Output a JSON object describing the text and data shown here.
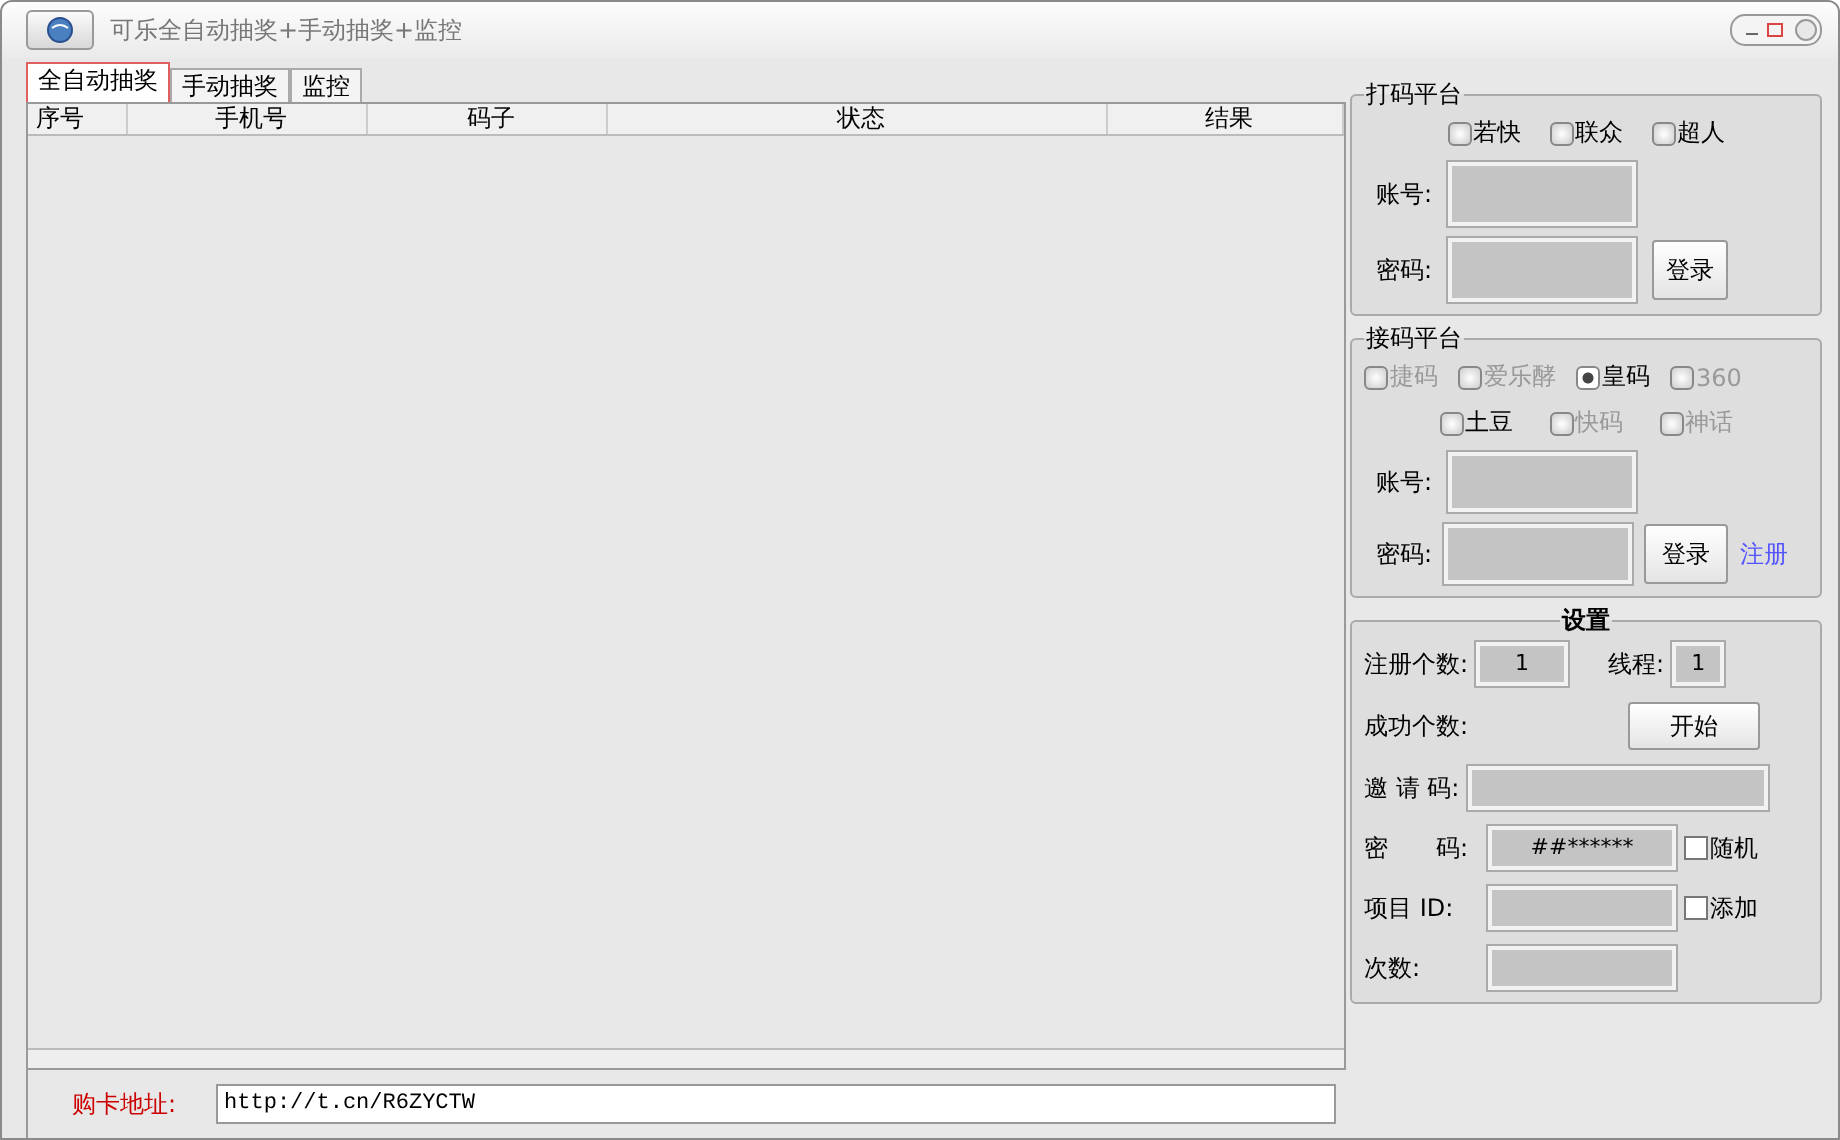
{
  "window": {
    "title": "可乐全自动抽奖+手动抽奖+监控"
  },
  "tabs": [
    {
      "label": "全自动抽奖",
      "selected": true
    },
    {
      "label": "手动抽奖",
      "selected": false
    },
    {
      "label": "监控",
      "selected": false
    }
  ],
  "table": {
    "columns": [
      "序号",
      "手机号",
      "码子",
      "状态",
      "结果"
    ]
  },
  "captcha_platform": {
    "title": "打码平台",
    "options": [
      {
        "label": "若快",
        "selected": false,
        "disabled": false
      },
      {
        "label": "联众",
        "selected": false,
        "disabled": false
      },
      {
        "label": "超人",
        "selected": false,
        "disabled": false
      }
    ],
    "account_label": "账号:",
    "password_label": "密码:",
    "login_button": "登录"
  },
  "sms_platform": {
    "title": "接码平台",
    "options_row1": [
      {
        "label": "捷码",
        "selected": false,
        "disabled": true
      },
      {
        "label": "爱乐酵",
        "selected": false,
        "disabled": true
      },
      {
        "label": "皇码",
        "selected": true,
        "disabled": false
      },
      {
        "label": "360",
        "selected": false,
        "disabled": true
      }
    ],
    "options_row2": [
      {
        "label": "土豆",
        "selected": false,
        "disabled": false
      },
      {
        "label": "快码",
        "selected": false,
        "disabled": true
      },
      {
        "label": "神话",
        "selected": false,
        "disabled": true
      }
    ],
    "account_label": "账号:",
    "password_label": "密码:",
    "login_button": "登录",
    "register_link": "注册"
  },
  "settings": {
    "title": "设置",
    "register_count_label": "注册个数:",
    "register_count": "1",
    "threads_label": "线程:",
    "threads": "1",
    "success_count_label": "成功个数:",
    "start_button": "开始",
    "invite_label": "邀 请 码:",
    "password_label": "密　　码:",
    "password_value": "##******",
    "random": {
      "label": "随机",
      "checked": false
    },
    "project_label": "项目 ID:",
    "add": {
      "label": "添加",
      "checked": false
    },
    "times_label": "次数:"
  },
  "footer": {
    "label": "购卡地址:",
    "url": "http://t.cn/R6ZYCTW"
  }
}
